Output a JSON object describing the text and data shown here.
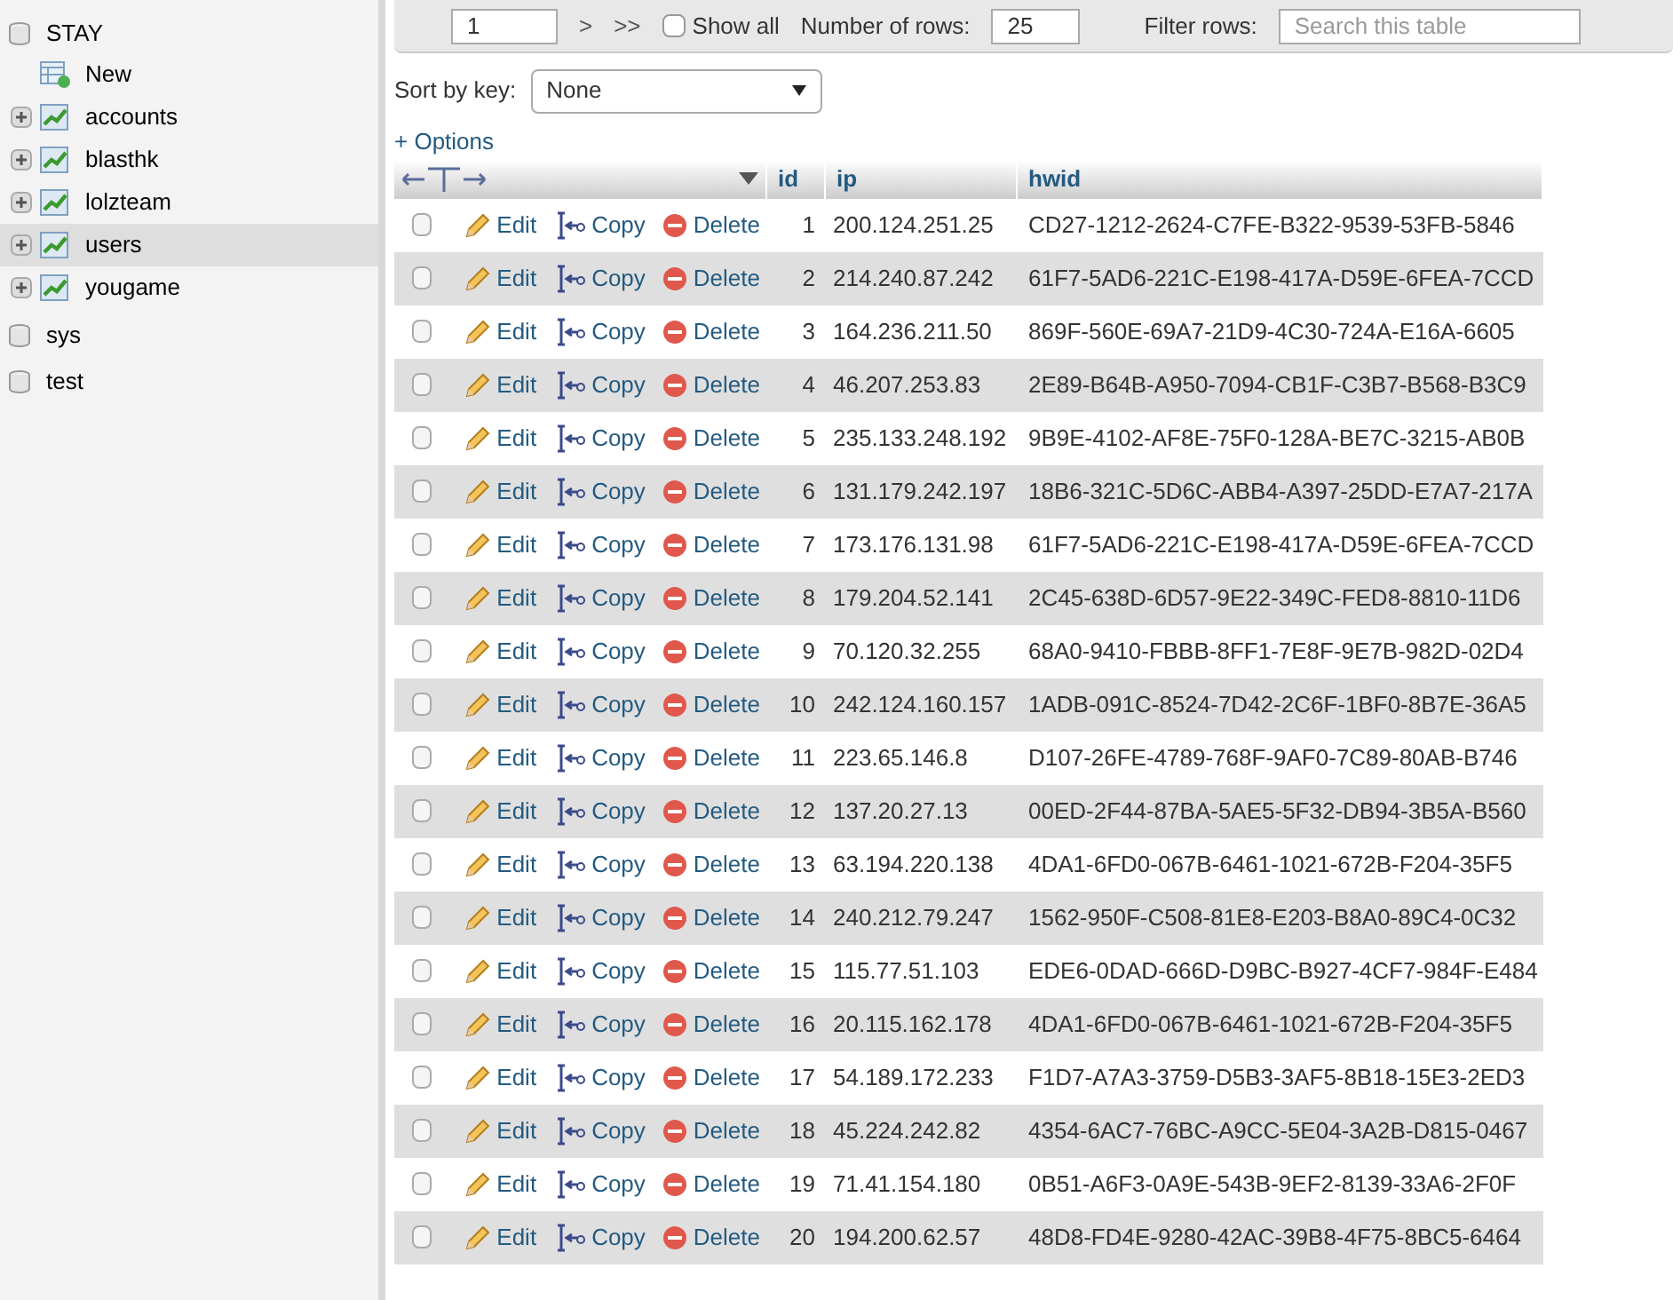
{
  "sidebar": {
    "databases": [
      {
        "name": "STAY",
        "children": [
          {
            "kind": "new",
            "name": "New",
            "selected": false
          },
          {
            "kind": "table",
            "name": "accounts",
            "selected": false,
            "expanded": false
          },
          {
            "kind": "table",
            "name": "blasthk",
            "selected": false,
            "expanded": false
          },
          {
            "kind": "table",
            "name": "lolzteam",
            "selected": false,
            "expanded": false
          },
          {
            "kind": "table",
            "name": "users",
            "selected": true,
            "expanded": false
          },
          {
            "kind": "table",
            "name": "yougame",
            "selected": false,
            "expanded": false
          }
        ]
      },
      {
        "name": "sys"
      },
      {
        "name": "test"
      }
    ]
  },
  "toolbar": {
    "page": "1",
    "next": ">",
    "last": ">>",
    "show_all": {
      "label": "Show all",
      "checked": false
    },
    "rows_label": "Number of rows:",
    "rows_value": "25",
    "filter_label": "Filter rows:",
    "filter_placeholder": "Search this table"
  },
  "sort": {
    "label": "Sort by key:",
    "value": "None"
  },
  "options_link": "+ Options",
  "table": {
    "columns": [
      "id",
      "ip",
      "hwid"
    ],
    "rows": [
      {
        "checked": false,
        "actions": [
          "Edit",
          "Copy",
          "Delete"
        ],
        "id": "1",
        "ip": "200.124.251.25",
        "hwid": "CD27-1212-2624-C7FE-B322-9539-53FB-5846"
      },
      {
        "checked": false,
        "actions": [
          "Edit",
          "Copy",
          "Delete"
        ],
        "id": "2",
        "ip": "214.240.87.242",
        "hwid": "61F7-5AD6-221C-E198-417A-D59E-6FEA-7CCD"
      },
      {
        "checked": false,
        "actions": [
          "Edit",
          "Copy",
          "Delete"
        ],
        "id": "3",
        "ip": "164.236.211.50",
        "hwid": "869F-560E-69A7-21D9-4C30-724A-E16A-6605"
      },
      {
        "checked": false,
        "actions": [
          "Edit",
          "Copy",
          "Delete"
        ],
        "id": "4",
        "ip": "46.207.253.83",
        "hwid": "2E89-B64B-A950-7094-CB1F-C3B7-B568-B3C9"
      },
      {
        "checked": false,
        "actions": [
          "Edit",
          "Copy",
          "Delete"
        ],
        "id": "5",
        "ip": "235.133.248.192",
        "hwid": "9B9E-4102-AF8E-75F0-128A-BE7C-3215-AB0B"
      },
      {
        "checked": false,
        "actions": [
          "Edit",
          "Copy",
          "Delete"
        ],
        "id": "6",
        "ip": "131.179.242.197",
        "hwid": "18B6-321C-5D6C-ABB4-A397-25DD-E7A7-217A"
      },
      {
        "checked": false,
        "actions": [
          "Edit",
          "Copy",
          "Delete"
        ],
        "id": "7",
        "ip": "173.176.131.98",
        "hwid": "61F7-5AD6-221C-E198-417A-D59E-6FEA-7CCD"
      },
      {
        "checked": false,
        "actions": [
          "Edit",
          "Copy",
          "Delete"
        ],
        "id": "8",
        "ip": "179.204.52.141",
        "hwid": "2C45-638D-6D57-9E22-349C-FED8-8810-11D6"
      },
      {
        "checked": false,
        "actions": [
          "Edit",
          "Copy",
          "Delete"
        ],
        "id": "9",
        "ip": "70.120.32.255",
        "hwid": "68A0-9410-FBBB-8FF1-7E8F-9E7B-982D-02D4"
      },
      {
        "checked": false,
        "actions": [
          "Edit",
          "Copy",
          "Delete"
        ],
        "id": "10",
        "ip": "242.124.160.157",
        "hwid": "1ADB-091C-8524-7D42-2C6F-1BF0-8B7E-36A5"
      },
      {
        "checked": false,
        "actions": [
          "Edit",
          "Copy",
          "Delete"
        ],
        "id": "11",
        "ip": "223.65.146.8",
        "hwid": "D107-26FE-4789-768F-9AF0-7C89-80AB-B746"
      },
      {
        "checked": false,
        "actions": [
          "Edit",
          "Copy",
          "Delete"
        ],
        "id": "12",
        "ip": "137.20.27.13",
        "hwid": "00ED-2F44-87BA-5AE5-5F32-DB94-3B5A-B560"
      },
      {
        "checked": false,
        "actions": [
          "Edit",
          "Copy",
          "Delete"
        ],
        "id": "13",
        "ip": "63.194.220.138",
        "hwid": "4DA1-6FD0-067B-6461-1021-672B-F204-35F5"
      },
      {
        "checked": false,
        "actions": [
          "Edit",
          "Copy",
          "Delete"
        ],
        "id": "14",
        "ip": "240.212.79.247",
        "hwid": "1562-950F-C508-81E8-E203-B8A0-89C4-0C32"
      },
      {
        "checked": false,
        "actions": [
          "Edit",
          "Copy",
          "Delete"
        ],
        "id": "15",
        "ip": "115.77.51.103",
        "hwid": "EDE6-0DAD-666D-D9BC-B927-4CF7-984F-E484"
      },
      {
        "checked": false,
        "actions": [
          "Edit",
          "Copy",
          "Delete"
        ],
        "id": "16",
        "ip": "20.115.162.178",
        "hwid": "4DA1-6FD0-067B-6461-1021-672B-F204-35F5"
      },
      {
        "checked": false,
        "actions": [
          "Edit",
          "Copy",
          "Delete"
        ],
        "id": "17",
        "ip": "54.189.172.233",
        "hwid": "F1D7-A7A3-3759-D5B3-3AF5-8B18-15E3-2ED3"
      },
      {
        "checked": false,
        "actions": [
          "Edit",
          "Copy",
          "Delete"
        ],
        "id": "18",
        "ip": "45.224.242.82",
        "hwid": "4354-6AC7-76BC-A9CC-5E04-3A2B-D815-0467"
      },
      {
        "checked": false,
        "actions": [
          "Edit",
          "Copy",
          "Delete"
        ],
        "id": "19",
        "ip": "71.41.154.180",
        "hwid": "0B51-A6F3-0A9E-543B-9EF2-8139-33A6-2F0F"
      },
      {
        "checked": false,
        "actions": [
          "Edit",
          "Copy",
          "Delete"
        ],
        "id": "20",
        "ip": "194.200.62.57",
        "hwid": "48D8-FD4E-9280-42AC-39B8-4F75-8BC5-6464"
      }
    ]
  }
}
